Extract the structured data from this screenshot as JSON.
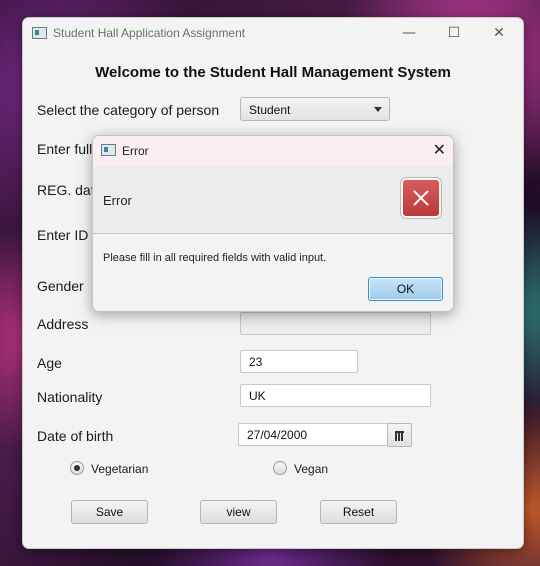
{
  "window": {
    "title": "Student Hall Application Assignment",
    "controls": {
      "minimize": "—",
      "maximize": "☐",
      "close": "✕"
    }
  },
  "form": {
    "heading": "Welcome to the Student Hall Management System",
    "category": {
      "label": "Select the category of person",
      "value": "Student"
    },
    "full_name": {
      "label_visible": "Enter full"
    },
    "reg_date": {
      "label_visible": "REG. dat"
    },
    "id": {
      "label_visible": "Enter ID"
    },
    "gender": {
      "label": "Gender"
    },
    "address": {
      "label": "Address",
      "value": ""
    },
    "age": {
      "label": "Age",
      "value": "23"
    },
    "nationality": {
      "label": "Nationality",
      "value": "UK"
    },
    "date_of_birth": {
      "label": "Date of birth",
      "value": "27/04/2000"
    },
    "diet": [
      {
        "label": "Vegetarian",
        "selected": true
      },
      {
        "label": "Vegan",
        "selected": false
      }
    ],
    "buttons": {
      "save": "Save",
      "view": "view",
      "reset": "Reset"
    }
  },
  "dialog": {
    "title": "Error",
    "close": "✕",
    "header": "Error",
    "icon": "error-icon",
    "message": "Please fill in all required fields with valid input.",
    "ok": "OK"
  },
  "colors": {
    "error_red": "#c94a4a",
    "ok_blue": "#9dcbec",
    "dialog_titlebar": "#fbeef2"
  }
}
